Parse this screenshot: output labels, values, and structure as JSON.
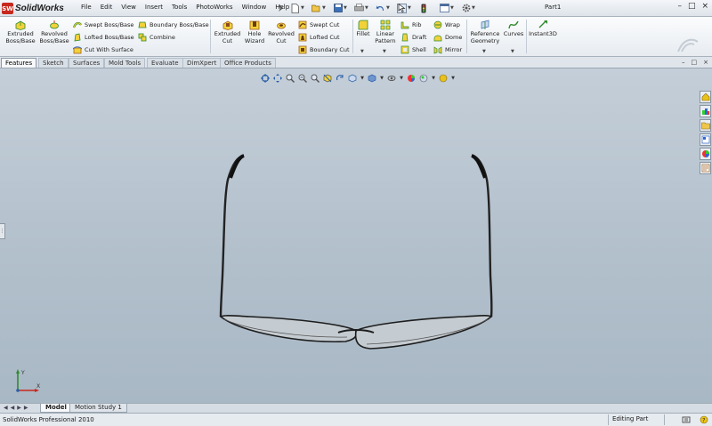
{
  "app": {
    "name": "SolidWorks",
    "badge": "SW",
    "document_title": "Part1"
  },
  "menu": [
    "File",
    "Edit",
    "View",
    "Insert",
    "Tools",
    "PhotoWorks",
    "Window",
    "Help"
  ],
  "quick_access": [
    "new-document-icon",
    "open-icon",
    "save-icon",
    "print-icon",
    "undo-icon",
    "select-icon",
    "rebuild-icon",
    "file-properties-icon",
    "options-icon"
  ],
  "window_controls": [
    "–",
    "□",
    "×"
  ],
  "ribbon": {
    "extruded_boss": "Extruded\nBoss/Base",
    "revolved_boss": "Revolved\nBoss/Base",
    "swept_boss": "Swept Boss/Base",
    "lofted_boss": "Lofted Boss/Base",
    "cut_with_surface": "Cut With Surface",
    "boundary_boss": "Boundary Boss/Base",
    "combine": "Combine",
    "extruded_cut": "Extruded\nCut",
    "hole_wizard": "Hole\nWizard",
    "revolved_cut": "Revolved\nCut",
    "swept_cut": "Swept Cut",
    "lofted_cut": "Lofted Cut",
    "boundary_cut": "Boundary Cut",
    "fillet": "Fillet",
    "linear_pattern": "Linear\nPattern",
    "rib": "Rib",
    "draft": "Draft",
    "shell": "Shell",
    "wrap": "Wrap",
    "dome": "Dome",
    "mirror": "Mirror",
    "reference_geometry": "Reference\nGeometry",
    "curves": "Curves",
    "instant3d": "Instant3D"
  },
  "tabs": [
    "Features",
    "Sketch",
    "Surfaces",
    "Mold Tools",
    "Evaluate",
    "DimXpert",
    "Office Products"
  ],
  "active_tab": "Features",
  "bottom_tabs": [
    "Model",
    "Motion Study 1"
  ],
  "status": {
    "product": "SolidWorks Professional 2010",
    "mode": "Editing Part"
  },
  "triad_labels": {
    "x": "X",
    "y": "Y"
  },
  "colors": {
    "viewport_top": "#c4ced8",
    "viewport_bottom": "#a9b8c5",
    "brand_red": "#c8281d",
    "accent_green": "#2f8a2f",
    "accent_yellow": "#e8c21a"
  }
}
